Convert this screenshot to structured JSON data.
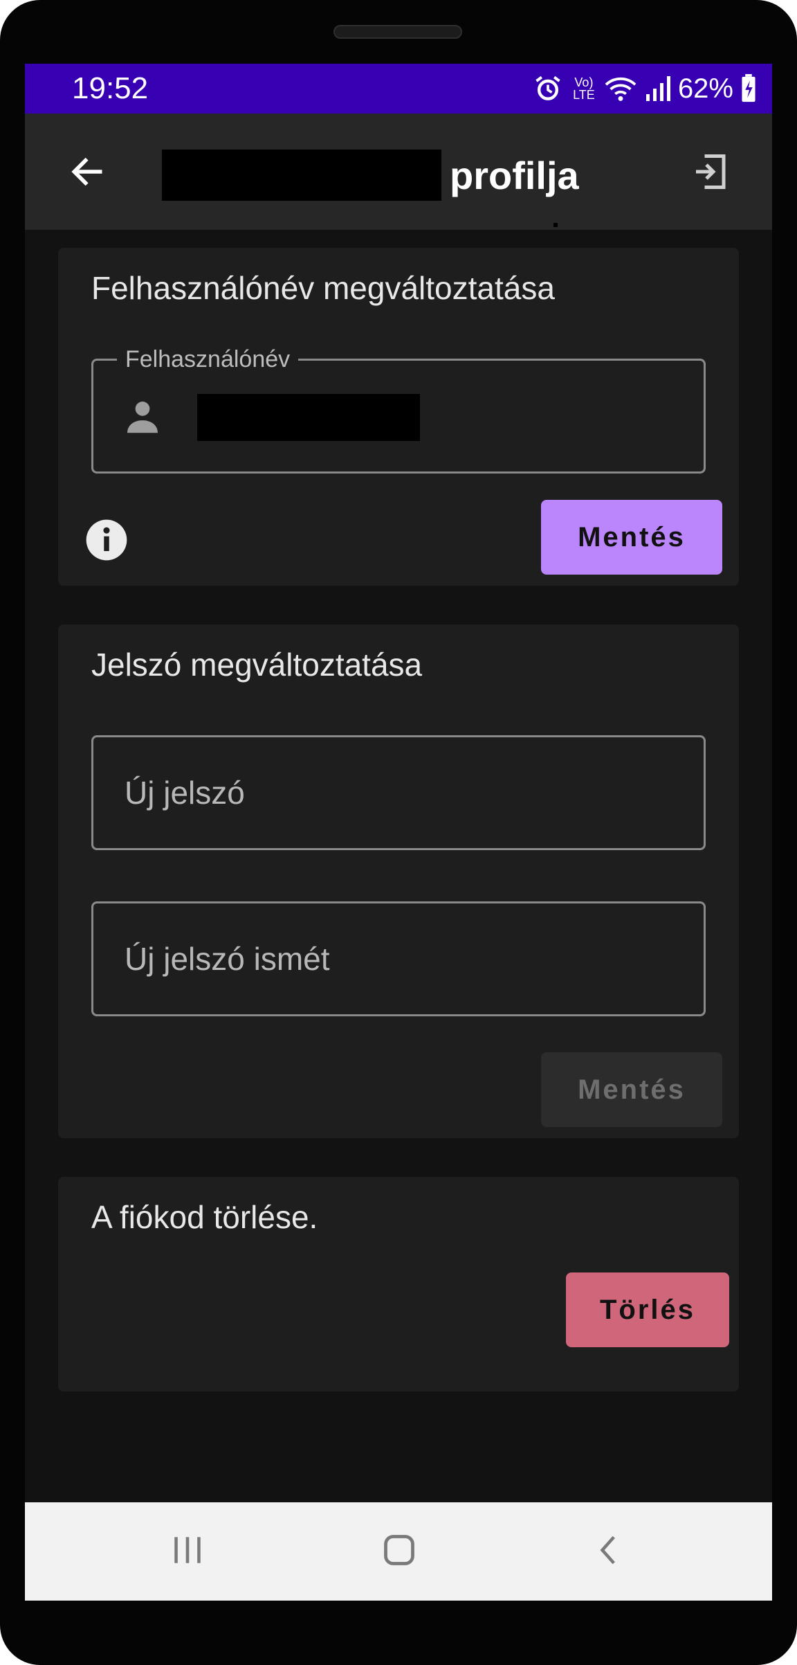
{
  "status_bar": {
    "time": "19:52",
    "network_label": "Vo) LTE",
    "battery": "62%"
  },
  "app_bar": {
    "title": "profilja",
    "back_icon": "arrow-left-icon",
    "logout_icon": "logout-icon"
  },
  "username_card": {
    "title": "Felhasználónév megváltoztatása",
    "field_label": "Felhasználónév",
    "field_icon": "person-icon",
    "info_icon": "info-icon",
    "save_label": "Mentés"
  },
  "password_card": {
    "title": "Jelszó megváltoztatása",
    "new_password_placeholder": "Új jelszó",
    "repeat_password_placeholder": "Új jelszó ismét",
    "save_label": "Mentés"
  },
  "delete_card": {
    "text": "A fiókod törlése.",
    "delete_label": "Törlés"
  },
  "nav_bar": {
    "recents_icon": "recents-icon",
    "home_icon": "home-icon",
    "back_icon": "chevron-left-icon"
  },
  "colors": {
    "status_bar": "#3700b3",
    "primary_button": "#bb86fc",
    "delete_button": "#cf6679",
    "disabled_button": "#2c2c2c",
    "background": "#121212",
    "card": "#1e1e1e"
  }
}
